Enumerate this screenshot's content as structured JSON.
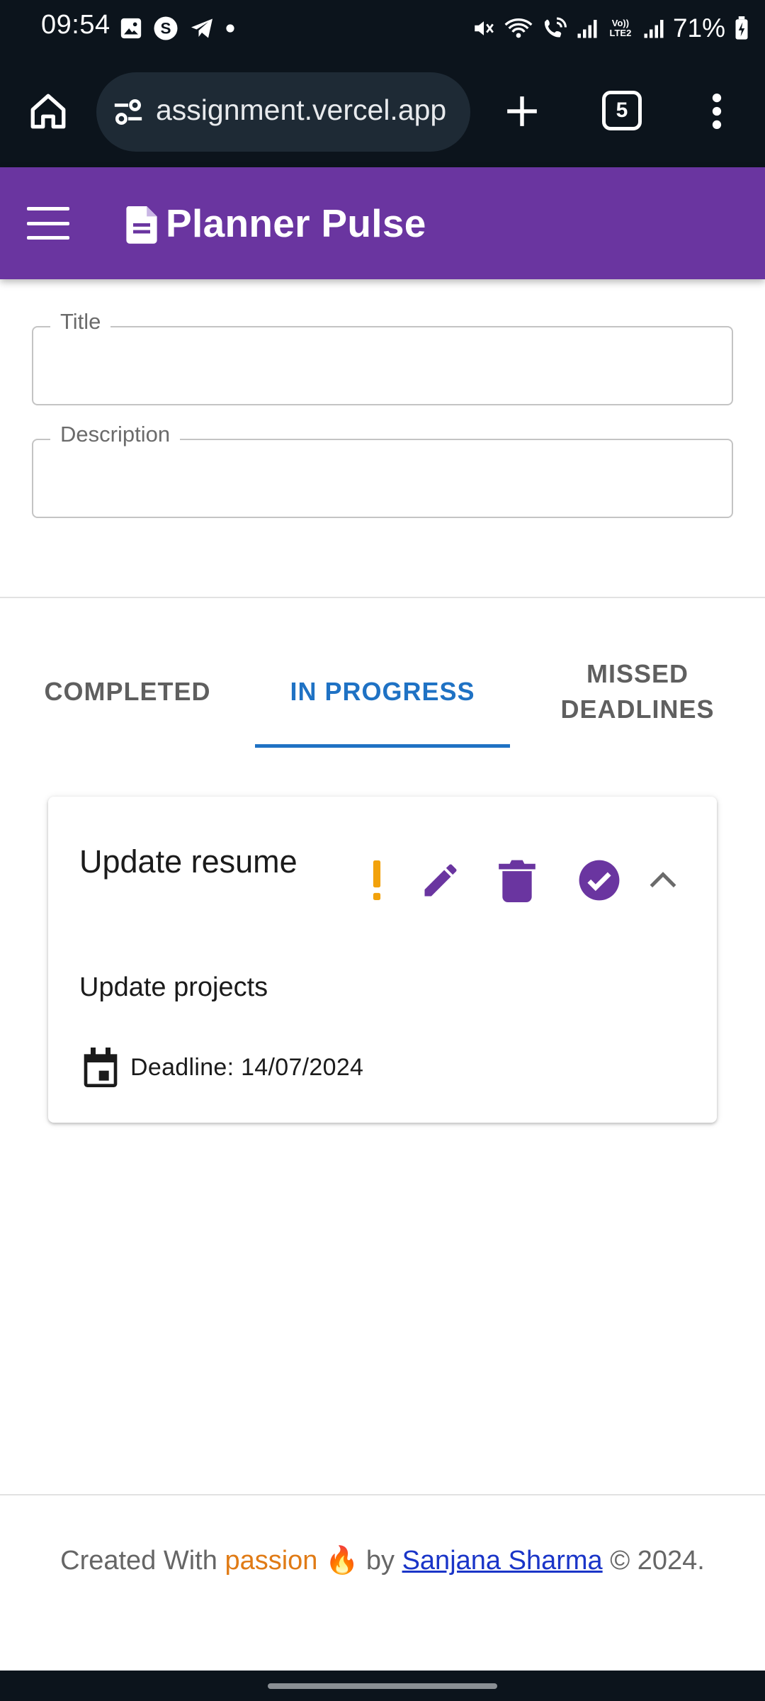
{
  "status_bar": {
    "time": "09:54",
    "battery": "71%",
    "network_label": "Vo)) LTE2",
    "left_icons": [
      "image-icon",
      "s-app-icon",
      "telegram-icon",
      "dot-icon"
    ],
    "right_icons": [
      "mute-icon",
      "wifi-icon",
      "wifi-call-icon",
      "signal-icon",
      "signal-icon",
      "battery-charging-icon"
    ]
  },
  "browser": {
    "url": "assignment.vercel.app",
    "tab_count": "5",
    "icons": [
      "home-icon",
      "site-settings-icon",
      "plus-icon",
      "tab-switcher-icon",
      "more-vert-icon"
    ]
  },
  "app_bar": {
    "title": "Planner Pulse",
    "icons": [
      "menu-icon",
      "document-icon"
    ],
    "color": "#6a35a0"
  },
  "form": {
    "title_label": "Title",
    "title_value": "",
    "description_label": "Description",
    "description_value": ""
  },
  "tabs": {
    "items": [
      {
        "label": "COMPLETED",
        "active": false
      },
      {
        "label": "IN PROGRESS",
        "active": true
      },
      {
        "label": "MISSED\nDEADLINES",
        "active": false
      }
    ],
    "active_color": "#1f72c4"
  },
  "task": {
    "title": "Update resume",
    "description": "Update projects",
    "deadline": "Deadline: 14/07/2024",
    "icons": [
      "priority-icon",
      "edit-icon",
      "delete-icon",
      "check-circle-icon",
      "chevron-up-icon",
      "calendar-icon"
    ],
    "priority_color": "#f2a20c",
    "action_color": "#6a35a0"
  },
  "footer": {
    "prefix": "Created With",
    "highlight": "passion",
    "emoji": "🔥",
    "by": "by",
    "author": "Sanjana Sharma",
    "suffix": "© 2024."
  }
}
